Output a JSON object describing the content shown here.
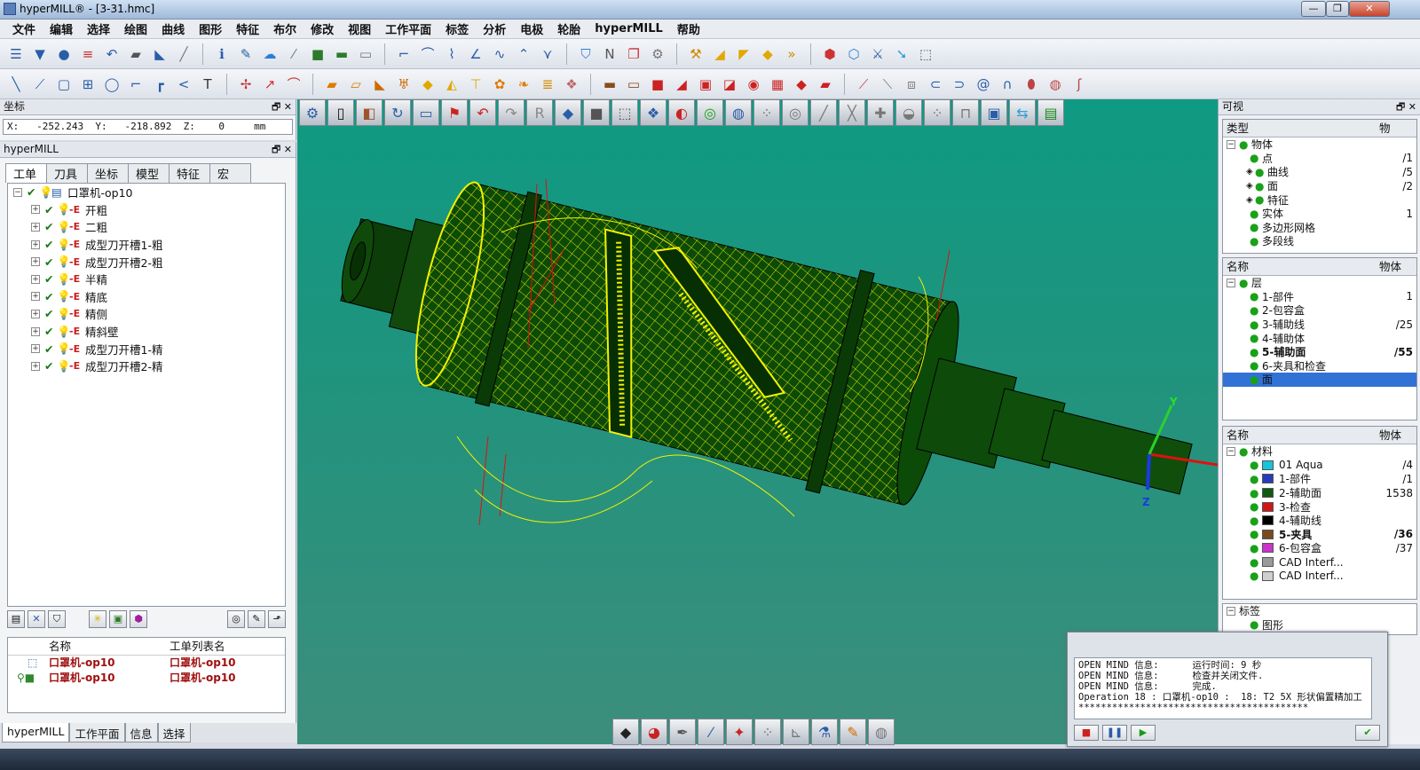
{
  "window": {
    "title": "hyperMILL® - [3-31.hmc]",
    "minimize": "—",
    "restore": "❐",
    "close": "✕"
  },
  "menu": [
    "文件",
    "编辑",
    "选择",
    "绘图",
    "曲线",
    "图形",
    "特征",
    "布尔",
    "修改",
    "视图",
    "工作平面",
    "标签",
    "分析",
    "电极",
    "轮胎",
    "hyperMILL",
    "帮助"
  ],
  "toolbar1_icons": [
    "layers-icon",
    "filter-icon",
    "pin-icon",
    "stack-icon",
    "undo-icon",
    "eraser-icon",
    "boot-icon",
    "wand-icon",
    "italic-icon",
    "pencil-icon",
    "cloud-icon",
    "brush-icon",
    "cube-icon",
    "plate-icon",
    "box-icon",
    "curve-icon",
    "arc-icon",
    "ruler-icon",
    "angle-icon",
    "wave-icon",
    "hat-icon",
    "funnel-icon",
    "n-icon",
    "copy-icon",
    "gear-icon",
    "hammer-icon"
  ],
  "toolbar2_icons": [
    "line-icon",
    "polyline-icon",
    "rect-icon",
    "circle-icon",
    "arc-icon",
    "spline-icon",
    "text-icon",
    "axis-icon",
    "plane-icon",
    "box-icon",
    "cylinder-icon",
    "cone-icon",
    "sphere-icon",
    "torus-icon",
    "chamfer-icon",
    "fillet-icon",
    "extrude-icon",
    "revolve-icon",
    "grid-icon",
    "trim-icon",
    "offset-icon",
    "sweep-icon"
  ],
  "coords": {
    "header": "坐标",
    "readout": "X:   -252.243  Y:   -218.892  Z:    0     mm"
  },
  "hypermill_panel": {
    "header": "hyperMILL",
    "tabs": [
      "工单",
      "刀具",
      "坐标",
      "模型",
      "特征",
      "宏"
    ],
    "job": "口罩机-op10",
    "operations": [
      "开粗",
      "二粗",
      "成型刀开槽1-粗",
      "成型刀开槽2-粗",
      "半精",
      "精底",
      "精侧",
      "精斜壁",
      "成型刀开槽1-精",
      "成型刀开槽2-精"
    ],
    "list_headers": [
      "名称",
      "工单列表名"
    ],
    "list_rows": [
      [
        "口罩机-op10",
        "口罩机-op10"
      ],
      [
        "口罩机-op10",
        "口罩机-op10"
      ]
    ]
  },
  "bottom_tabs": [
    "hyperMILL",
    "工作平面",
    "信息",
    "选择"
  ],
  "visibility_panel": {
    "header": "可视",
    "col_type": "类型",
    "col_obj": "物",
    "root": "物体",
    "items": [
      {
        "name": "点",
        "val": "/1"
      },
      {
        "name": "曲线",
        "val": "/5"
      },
      {
        "name": "面",
        "val": "/2"
      },
      {
        "name": "特征",
        "val": ""
      },
      {
        "name": "实体",
        "val": "1"
      },
      {
        "name": "多边形网格",
        "val": ""
      },
      {
        "name": "多段线",
        "val": ""
      }
    ]
  },
  "layers_panel": {
    "col_name": "名称",
    "col_obj": "物体",
    "root": "层",
    "items": [
      {
        "name": "1-部件",
        "val": "1"
      },
      {
        "name": "2-包容盒",
        "val": ""
      },
      {
        "name": "3-辅助线",
        "val": "/25"
      },
      {
        "name": "4-辅助体",
        "val": ""
      },
      {
        "name": "5-辅助面",
        "val": "/55"
      },
      {
        "name": "6-夹具和检查",
        "val": ""
      },
      {
        "name": "面",
        "val": ""
      }
    ]
  },
  "materials_panel": {
    "col_name": "名称",
    "col_obj": "物体",
    "root": "材料",
    "items": [
      {
        "name": "01 Aqua",
        "val": "/4",
        "color": "#19c3d9"
      },
      {
        "name": "1-部件",
        "val": "/1",
        "color": "#2a3ab8"
      },
      {
        "name": "2-辅助面",
        "val": "1538",
        "color": "#0f5a12"
      },
      {
        "name": "3-检查",
        "val": "",
        "color": "#d11616"
      },
      {
        "name": "4-辅助线",
        "val": "",
        "color": "#000000"
      },
      {
        "name": "5-夹具",
        "val": "/36",
        "color": "#7a4a1e"
      },
      {
        "name": "6-包容盒",
        "val": "/37",
        "color": "#cc33cc"
      },
      {
        "name": "CAD Interf...",
        "val": "",
        "color": "#9a9a9a"
      },
      {
        "name": "CAD Interf...",
        "val": "",
        "color": "#cfcfcf"
      }
    ]
  },
  "tags_panel": {
    "root": "标签",
    "child": "图形"
  },
  "messages": [
    "OPEN MIND 信息:      运行时间: 9 秒",
    "OPEN MIND 信息:      检查并关闭文件.",
    "OPEN MIND 信息:      完成.",
    "Operation 18 : 口罩机-op10 :  18: T2 5X 形状偏置精加工",
    "*****************************************"
  ],
  "viewport": {
    "axis_y": "Y",
    "axis_z": "Z",
    "bg_top": "#0f9a83",
    "bg_bottom": "#3c8e7c"
  }
}
